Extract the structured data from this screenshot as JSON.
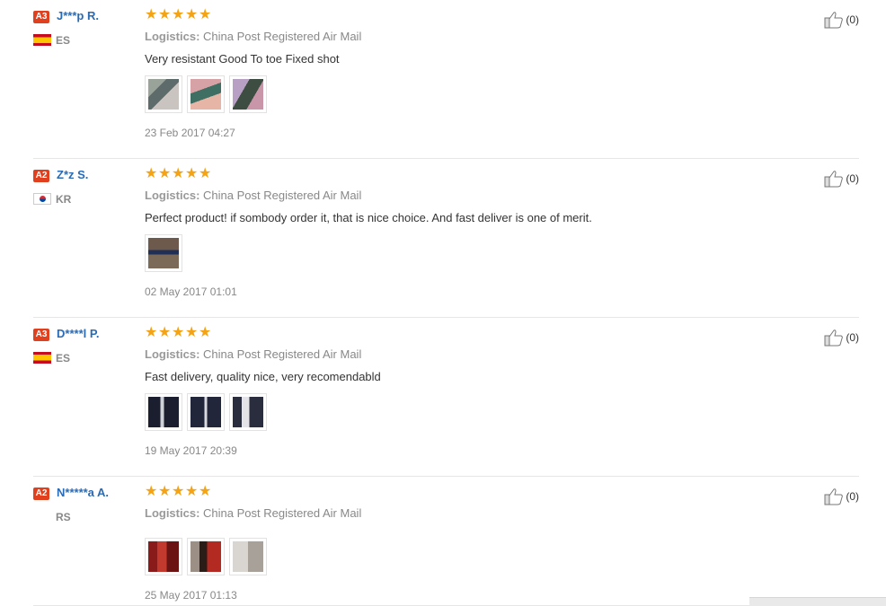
{
  "reviews": [
    {
      "level": "A3",
      "name": "J***p R.",
      "country": "ES",
      "flag": "spain-flag",
      "rating": 5,
      "logistics_label": "Logistics:",
      "logistics": "China Post Registered Air Mail",
      "text": "Very resistant Good To toe Fixed shot",
      "photos": 3,
      "date": "23 Feb 2017 04:27",
      "likes": "(0)"
    },
    {
      "level": "A2",
      "name": "Z*z S.",
      "country": "KR",
      "flag": "south-korea-flag",
      "rating": 5,
      "logistics_label": "Logistics:",
      "logistics": "China Post Registered Air Mail",
      "text": "Perfect product! if sombody order it, that is nice choice. And fast deliver is one of merit.",
      "photos": 1,
      "date": "02 May 2017 01:01",
      "likes": "(0)"
    },
    {
      "level": "A3",
      "name": "D****l P.",
      "country": "ES",
      "flag": "spain-flag",
      "rating": 5,
      "logistics_label": "Logistics:",
      "logistics": "China Post Registered Air Mail",
      "text": "Fast delivery, quality nice, very recomendabld",
      "photos": 3,
      "date": "19 May 2017 20:39",
      "likes": "(0)"
    },
    {
      "level": "A2",
      "name": "N*****a A.",
      "country": "RS",
      "flag": "serbia-flag",
      "rating": 5,
      "logistics_label": "Logistics:",
      "logistics": "China Post Registered Air Mail",
      "text": "",
      "photos": 3,
      "date": "25 May 2017 01:13",
      "likes": "(0)"
    }
  ],
  "colors": {
    "badge": "#e0401d",
    "name": "#2a6bb4",
    "star": "#f4a314",
    "muted": "#888888"
  }
}
